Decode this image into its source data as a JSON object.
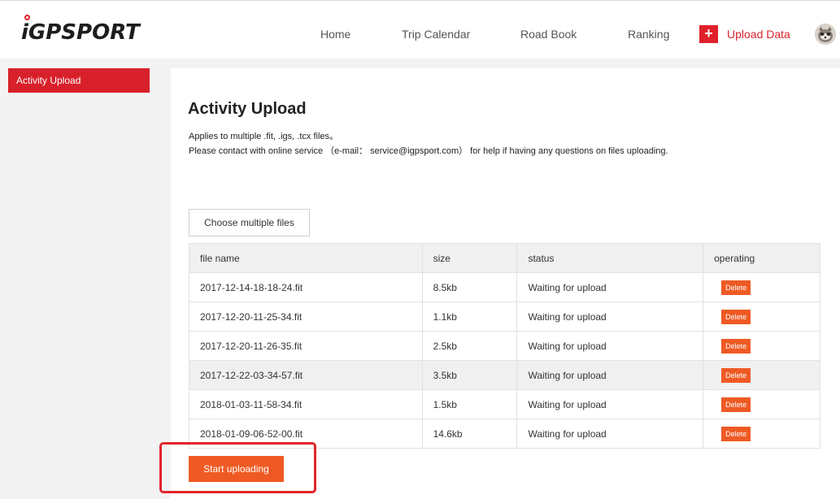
{
  "header": {
    "logo": "iGPSPORT",
    "nav": [
      "Home",
      "Trip Calendar",
      "Road Book",
      "Ranking"
    ],
    "upload_label": "Upload Data",
    "accent_color": "#e0202a"
  },
  "sidebar": {
    "items": [
      {
        "label": "Activity Upload",
        "active": true
      }
    ]
  },
  "main": {
    "title": "Activity Upload",
    "desc_line1": "Applies to multiple .fit, .igs, .tcx files。",
    "desc_line2": "Please contact with online service （e-mail： service@igpsport.com） for help if having any questions on files uploading.",
    "choose_label": "Choose multiple files",
    "table": {
      "columns": [
        "file name",
        "size",
        "status",
        "operating"
      ],
      "rows": [
        {
          "name": "2017-12-14-18-18-24.fit",
          "size": "8.5kb",
          "status": "Waiting for upload",
          "action": "Delete"
        },
        {
          "name": "2017-12-20-11-25-34.fit",
          "size": "1.1kb",
          "status": "Waiting for upload",
          "action": "Delete"
        },
        {
          "name": "2017-12-20-11-26-35.fit",
          "size": "2.5kb",
          "status": "Waiting for upload",
          "action": "Delete"
        },
        {
          "name": "2017-12-22-03-34-57.fit",
          "size": "3.5kb",
          "status": "Waiting for upload",
          "action": "Delete"
        },
        {
          "name": "2018-01-03-11-58-34.fit",
          "size": "1.5kb",
          "status": "Waiting for upload",
          "action": "Delete"
        },
        {
          "name": "2018-01-09-06-52-00.fit",
          "size": "14.6kb",
          "status": "Waiting for upload",
          "action": "Delete"
        }
      ]
    },
    "start_label": "Start uploading",
    "button_color": "#ef5a24"
  }
}
